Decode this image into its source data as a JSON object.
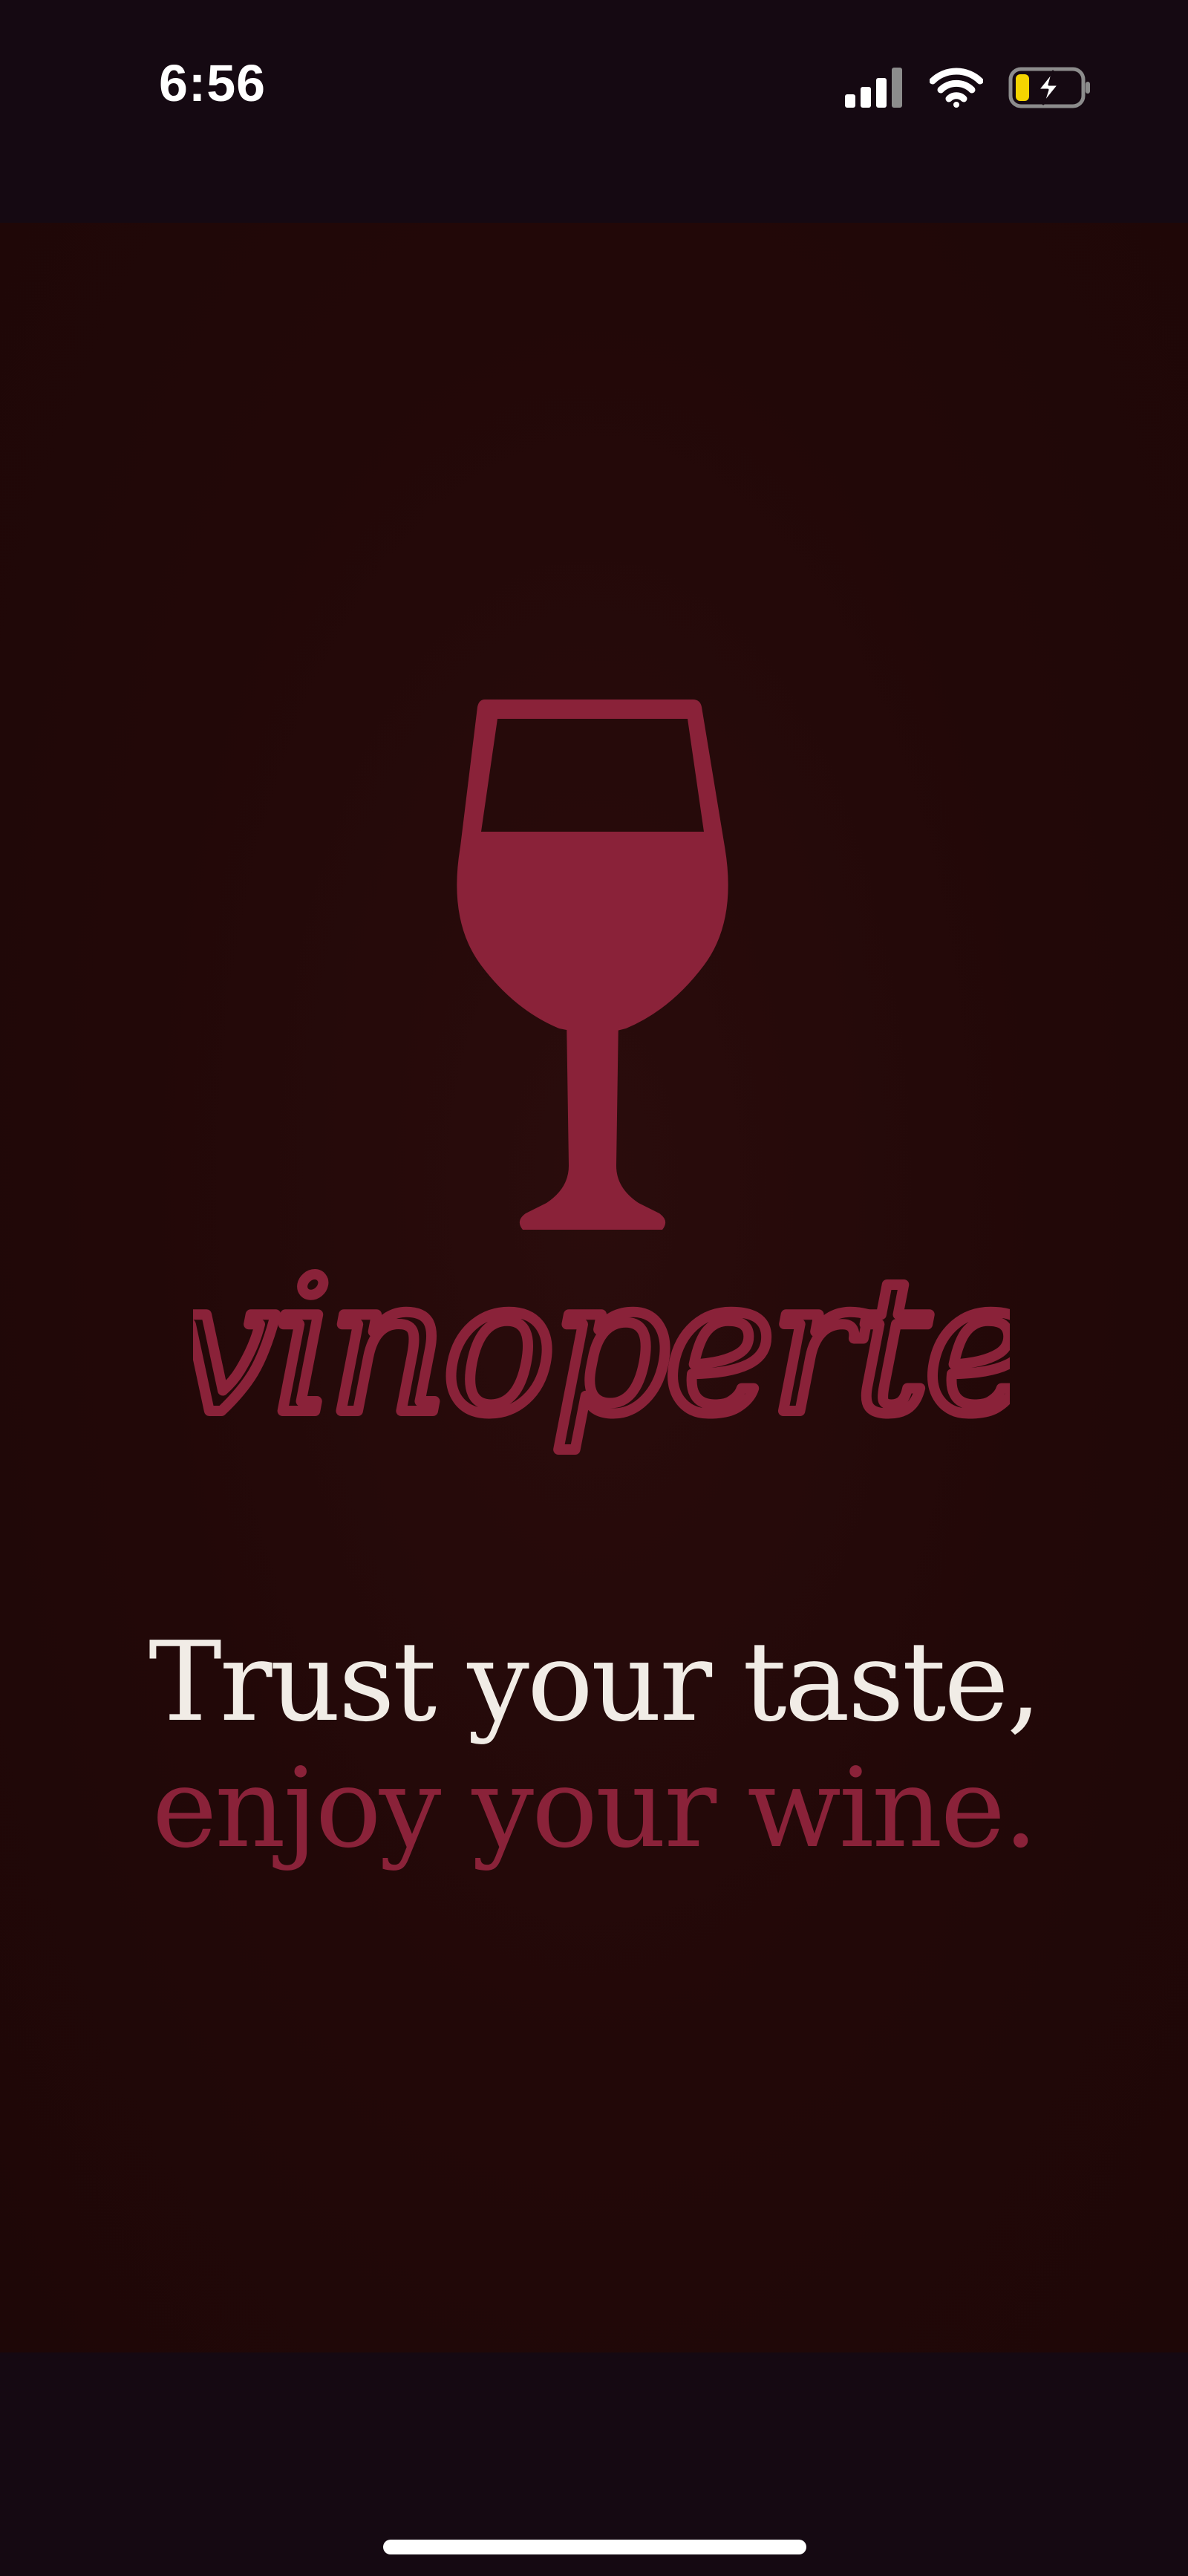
{
  "status_bar": {
    "time": "6:56",
    "icons": [
      "cellular-signal-icon",
      "wifi-icon",
      "battery-charging-icon"
    ],
    "battery_level": 0.2,
    "battery_color": "#f5d400"
  },
  "brand": {
    "logo_icon": "wine-glass-icon",
    "wordmark": "vinoperte",
    "color": "#8a2239"
  },
  "tagline": {
    "line1": "Trust your taste,",
    "line2": "enjoy your wine."
  },
  "colors": {
    "background": "#230909",
    "bars": "#150912",
    "accent": "#8a2239",
    "text_light": "#f1ece6"
  }
}
